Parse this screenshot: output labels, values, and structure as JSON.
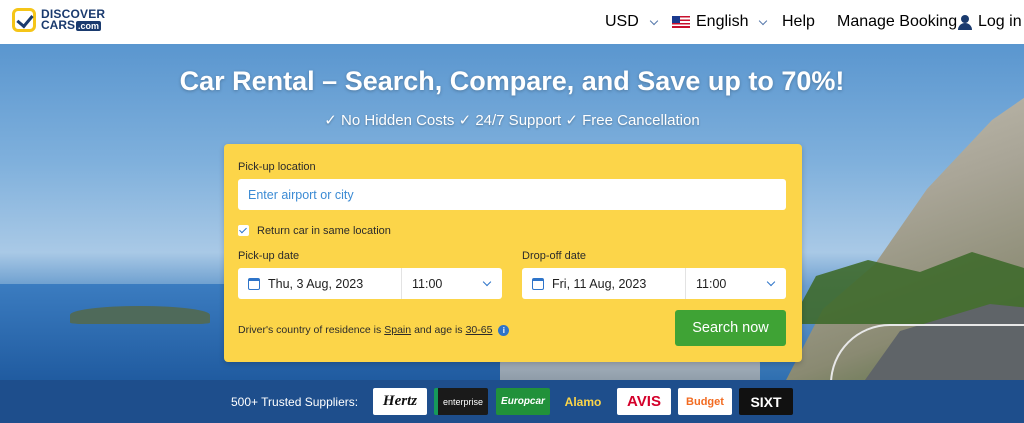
{
  "logo": {
    "line1": "DISCOVER",
    "line2": "CARS",
    "suffix": ".com"
  },
  "nav": {
    "currency": "USD",
    "language": "English",
    "help": "Help",
    "manage_booking": "Manage Booking",
    "login": "Log in"
  },
  "hero": {
    "title": "Car Rental – Search, Compare, and Save up to 70%!",
    "subtitle": "✓ No Hidden Costs ✓ 24/7 Support ✓ Free Cancellation"
  },
  "search": {
    "pickup_location_label": "Pick-up location",
    "pickup_location_placeholder": "Enter airport or city",
    "pickup_location_value": "",
    "return_same_label": "Return car in same location",
    "return_same_checked": true,
    "pickup_date_label": "Pick-up date",
    "pickup_date": "Thu, 3 Aug, 2023",
    "pickup_time": "11:00",
    "dropoff_date_label": "Drop-off date",
    "dropoff_date": "Fri, 11 Aug, 2023",
    "dropoff_time": "11:00",
    "residence_prefix": "Driver's country of residence is",
    "residence_country": "Spain",
    "residence_mid": "and age is",
    "residence_age": "30-65",
    "search_button": "Search now"
  },
  "suppliers": {
    "label": "500+ Trusted Suppliers:",
    "brands": [
      "Hertz",
      "enterprise",
      "Europcar",
      "Alamo",
      "AVIS",
      "Budget",
      "SIXT"
    ]
  },
  "colors": {
    "panel": "#fcd549",
    "search_button": "#3fa335",
    "suppliers_bar": "#1e4e8c",
    "nav_text": "#1a3a6e"
  }
}
